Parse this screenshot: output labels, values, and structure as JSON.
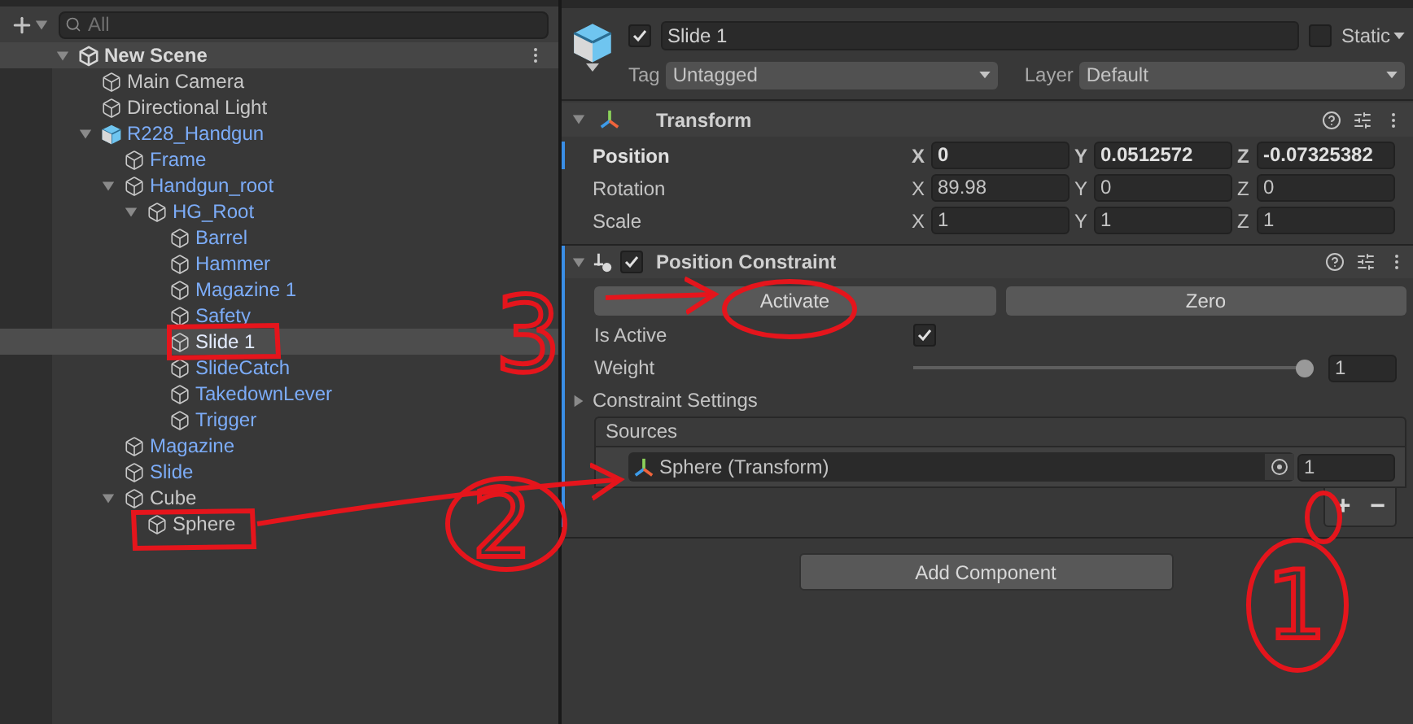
{
  "hierarchy": {
    "search": {
      "placeholder": "All"
    },
    "scene": {
      "name": "New Scene",
      "expanded": true
    },
    "items": [
      {
        "name": "Main Camera",
        "prefab": false,
        "selected": false
      },
      {
        "name": "Directional Light",
        "prefab": false,
        "selected": false
      },
      {
        "name": "R228_Handgun",
        "prefab": true,
        "root": true,
        "selected": false,
        "expanded": true,
        "children": [
          {
            "name": "Frame",
            "prefab": true,
            "selected": false
          },
          {
            "name": "Handgun_root",
            "prefab": true,
            "selected": false,
            "expanded": true,
            "children": [
              {
                "name": "HG_Root",
                "prefab": true,
                "selected": false,
                "expanded": true,
                "children": [
                  {
                    "name": "Barrel",
                    "prefab": true,
                    "selected": false
                  },
                  {
                    "name": "Hammer",
                    "prefab": true,
                    "selected": false
                  },
                  {
                    "name": "Magazine 1",
                    "prefab": true,
                    "selected": false
                  },
                  {
                    "name": "Safety",
                    "prefab": true,
                    "selected": false
                  },
                  {
                    "name": "Slide 1",
                    "prefab": true,
                    "selected": true
                  },
                  {
                    "name": "SlideCatch",
                    "prefab": true,
                    "selected": false
                  },
                  {
                    "name": "TakedownLever",
                    "prefab": true,
                    "selected": false
                  },
                  {
                    "name": "Trigger",
                    "prefab": true,
                    "selected": false
                  }
                ]
              }
            ]
          },
          {
            "name": "Magazine",
            "prefab": true,
            "selected": false
          },
          {
            "name": "Slide",
            "prefab": true,
            "selected": false
          },
          {
            "name": "Cube",
            "prefab": false,
            "selected": false,
            "expanded": true,
            "children": [
              {
                "name": "Sphere",
                "prefab": false,
                "selected": false
              }
            ]
          }
        ]
      }
    ]
  },
  "inspector": {
    "object": {
      "active": true,
      "name": "Slide 1",
      "static": false,
      "static_label": "Static"
    },
    "tag": {
      "label": "Tag",
      "value": "Untagged"
    },
    "layer": {
      "label": "Layer",
      "value": "Default"
    },
    "transform": {
      "title": "Transform",
      "expanded": true,
      "rows": [
        {
          "label": "Position",
          "selected": true,
          "fields": [
            {
              "axis": "X",
              "value": "0"
            },
            {
              "axis": "Y",
              "value": "0.0512572"
            },
            {
              "axis": "Z",
              "value": "-0.07325382"
            }
          ]
        },
        {
          "label": "Rotation",
          "selected": false,
          "fields": [
            {
              "axis": "X",
              "value": "89.98"
            },
            {
              "axis": "Y",
              "value": "0"
            },
            {
              "axis": "Z",
              "value": "0"
            }
          ]
        },
        {
          "label": "Scale",
          "selected": false,
          "fields": [
            {
              "axis": "X",
              "value": "1"
            },
            {
              "axis": "Y",
              "value": "1"
            },
            {
              "axis": "Z",
              "value": "1"
            }
          ]
        }
      ]
    },
    "constraint": {
      "title": "Position Constraint",
      "enabled": true,
      "expanded": true,
      "highlighted": true,
      "buttons": [
        "Activate",
        "Zero"
      ],
      "is_active": {
        "label": "Is Active",
        "checked": true
      },
      "weight": {
        "label": "Weight",
        "level": 1,
        "value": "1"
      },
      "settings": {
        "label": "Constraint Settings",
        "expanded": false
      },
      "sources": {
        "title": "Sources",
        "items": [
          {
            "name": "Sphere (Transform)",
            "weight": "1"
          }
        ],
        "add": "+",
        "remove": "−"
      }
    },
    "add_component": "Add Component"
  },
  "annotations": [
    {
      "label": "3"
    },
    {
      "label": "2"
    },
    {
      "label": "1"
    }
  ]
}
